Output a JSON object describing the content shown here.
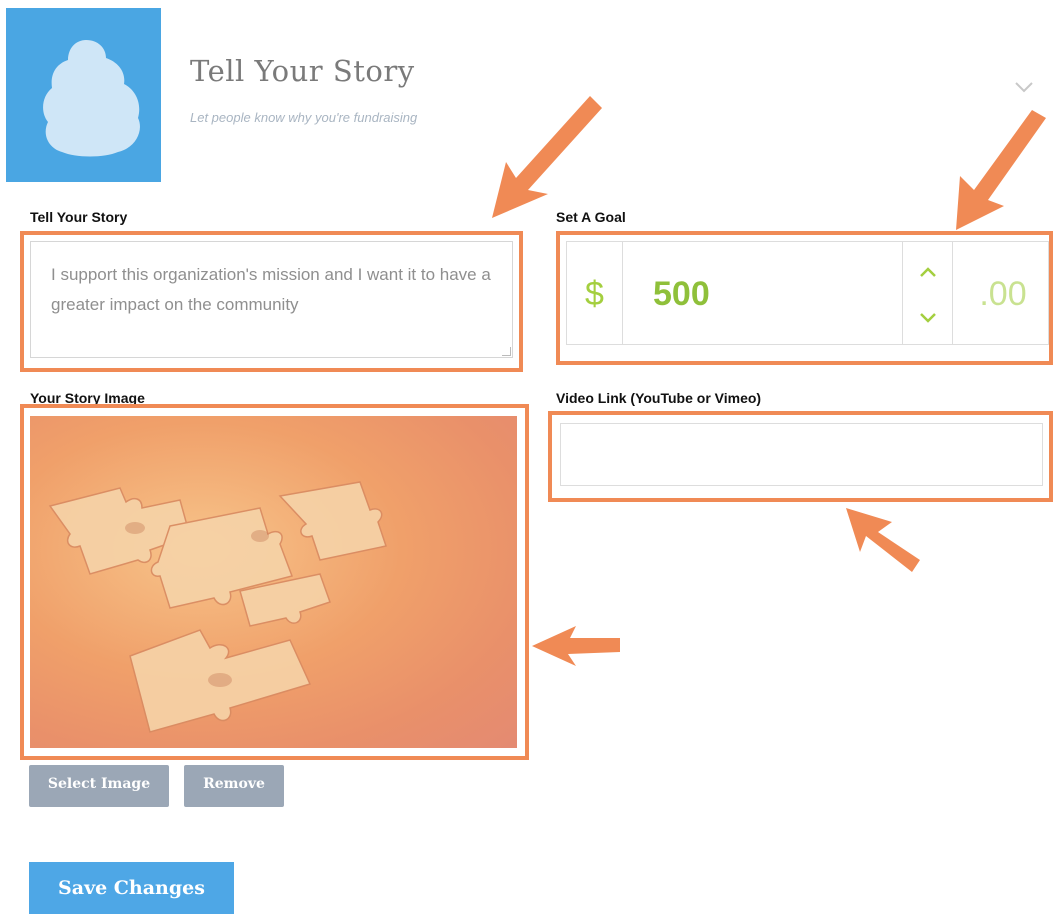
{
  "header": {
    "title": "Tell Your Story",
    "subtitle": "Let people know why you're fundraising",
    "icon": "campaign-avatar-icon",
    "accent_color": "#4aa6e3"
  },
  "story": {
    "label": "Tell Your Story",
    "value": "I support this organization's mission and I want it to have a greater impact on the community"
  },
  "goal": {
    "label": "Set A Goal",
    "currency": "$",
    "amount": "500",
    "cents": ".00"
  },
  "story_image": {
    "label": "Your Story Image",
    "select_button": "Select Image",
    "remove_button": "Remove"
  },
  "video": {
    "label": "Video Link (YouTube or Vimeo)",
    "value": ""
  },
  "actions": {
    "save_label": "Save Changes"
  },
  "colors": {
    "highlight": "#f08a55",
    "goal_green": "#8fc03a",
    "save_blue": "#4ea7e6",
    "secondary_button": "#9ba7b6"
  }
}
